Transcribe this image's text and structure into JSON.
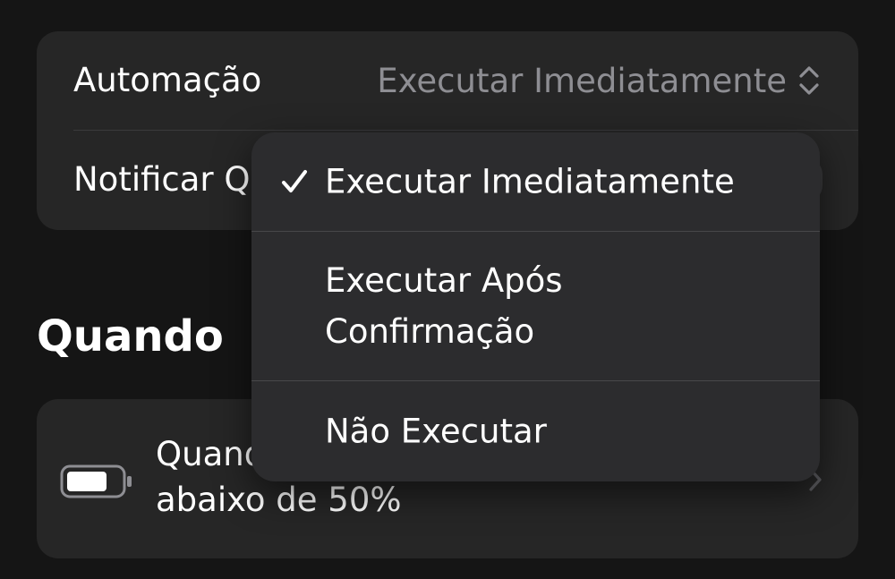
{
  "settings": {
    "automation_label": "Automação",
    "automation_value": "Executar Imediatamente",
    "notify_label": "Notificar Q"
  },
  "section": {
    "title": "Quando"
  },
  "trigger": {
    "line1": "Quand",
    "line2": "abaixo de 50%",
    "icon": "battery-icon"
  },
  "menu": {
    "items": [
      {
        "label": "Executar Imediatamente",
        "selected": true
      },
      {
        "label": "Executar Após Confirmação",
        "selected": false
      },
      {
        "label": "Não Executar",
        "selected": false
      }
    ]
  },
  "colors": {
    "background": "#151515",
    "card": "#262626",
    "menu": "#2c2c2e",
    "secondary_text": "#8e8e93",
    "separator": "#3a3a3c"
  }
}
